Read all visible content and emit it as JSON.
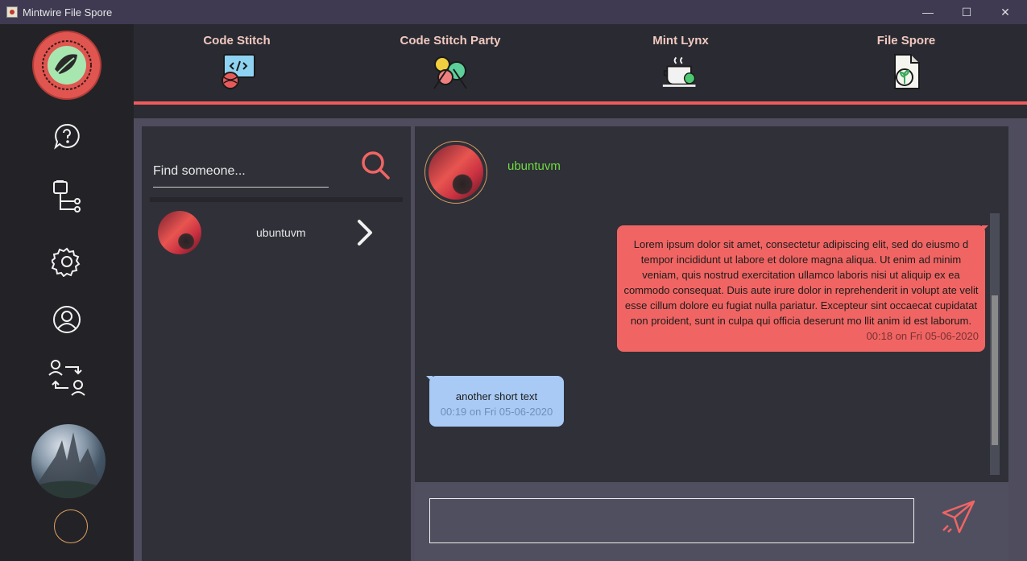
{
  "window": {
    "title": "Mintwire File Spore",
    "minimize_glyph": "—",
    "maximize_glyph": "☐",
    "close_glyph": "✕"
  },
  "sidebar": {
    "icons": [
      "help-icon",
      "file-tree-icon",
      "settings-icon",
      "user-profile-icon",
      "user-switch-icon"
    ]
  },
  "topnav": {
    "items": [
      {
        "label": "Code Stitch",
        "icon": "code-stitch-icon"
      },
      {
        "label": "Code Stitch Party",
        "icon": "code-stitch-party-icon"
      },
      {
        "label": "Mint Lynx",
        "icon": "mint-lynx-icon"
      },
      {
        "label": "File Spore",
        "icon": "file-spore-icon"
      }
    ],
    "accent": "#ef5b5b"
  },
  "contacts": {
    "search_placeholder": "Find someone...",
    "list": [
      {
        "name": "ubuntuvm"
      }
    ]
  },
  "chat": {
    "peer_name": "ubuntuvm",
    "peer_name_color": "#6fdc40",
    "messages": [
      {
        "direction": "sent",
        "text": "Lorem ipsum dolor sit amet, consectetur adipiscing elit, sed do eiusmo d tempor incididunt ut labore et dolore magna aliqua. Ut enim ad minim veniam, quis nostrud exercitation ullamco laboris nisi ut aliquip ex ea commodo consequat. Duis aute irure dolor in reprehenderit in volupt ate velit esse cillum dolore eu fugiat nulla pariatur. Excepteur sint occaecat cupidatat non proident, sunt in culpa qui officia deserunt mo llit anim id est laborum.",
        "time": "00:18 on Fri 05-06-2020",
        "color": "#f06563"
      },
      {
        "direction": "received",
        "text": "another short text",
        "time": "00:19 on Fri 05-06-2020",
        "color": "#a8caf5"
      }
    ],
    "composer_value": ""
  }
}
